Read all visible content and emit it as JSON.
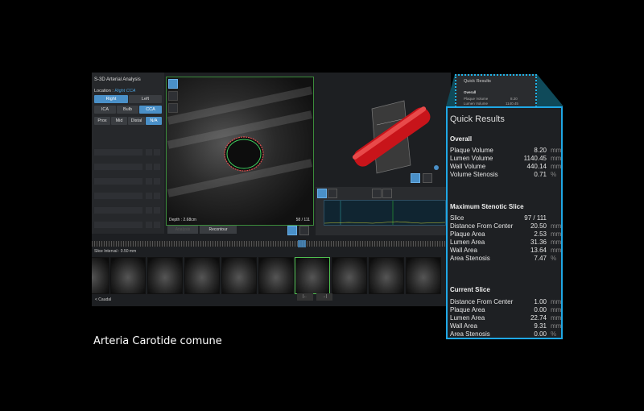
{
  "app": {
    "title": "S-3D Arterial Analysis",
    "location_label": "Location :",
    "location_value": "Right CCA",
    "side_buttons": [
      "Right",
      "Left"
    ],
    "segment_buttons": [
      "ICA",
      "Bulb",
      "CCA"
    ],
    "position_buttons": [
      "Prox",
      "Mid",
      "Distal",
      "N/A"
    ],
    "depth": "Depth : 2.68cm",
    "slice_counter": "58 / 111",
    "analysis_button": "Analysis",
    "recontour_button": "Recontour",
    "slice_interval": "Slice Interval : 0.50 mm",
    "caudal": "< Caudal",
    "nav_prev": "|←",
    "nav_next": "→|",
    "accent_color": "#4a90c8"
  },
  "quick_results_small": {
    "title": "Quick Results",
    "overall": "Overall",
    "rows": [
      {
        "label": "Plaque Volume",
        "value": "8.20"
      },
      {
        "label": "Lumen Volume",
        "value": "1140.45"
      }
    ]
  },
  "quick_results": {
    "title": "Quick Results",
    "border_color": "#1fa8e6",
    "overall": {
      "heading": "Overall",
      "rows": [
        {
          "label": "Plaque Volume",
          "value": "8.20",
          "unit": "mm"
        },
        {
          "label": "Lumen Volume",
          "value": "1140.45",
          "unit": "mm"
        },
        {
          "label": "Wall Volume",
          "value": "440.14",
          "unit": "mm"
        },
        {
          "label": "Volume Stenosis",
          "value": "0.71",
          "unit": "%"
        }
      ]
    },
    "max_stenotic": {
      "heading": "Maximum Stenotic Slice",
      "rows": [
        {
          "label": "Slice",
          "value": "97 / 111",
          "unit": ""
        },
        {
          "label": "Distance From Center",
          "value": "20.50",
          "unit": "mm"
        },
        {
          "label": "Plaque Area",
          "value": "2.53",
          "unit": "mm"
        },
        {
          "label": "Lumen Area",
          "value": "31.36",
          "unit": "mm"
        },
        {
          "label": "Wall Area",
          "value": "13.64",
          "unit": "mm"
        },
        {
          "label": "Area Stenosis",
          "value": "7.47",
          "unit": "%"
        }
      ]
    },
    "current": {
      "heading": "Current Slice",
      "rows": [
        {
          "label": "Distance From Center",
          "value": "1.00",
          "unit": "mm"
        },
        {
          "label": "Plaque Area",
          "value": "0.00",
          "unit": "mm"
        },
        {
          "label": "Lumen Area",
          "value": "22.74",
          "unit": "mm"
        },
        {
          "label": "Wall Area",
          "value": "9.31",
          "unit": "mm"
        },
        {
          "label": "Area Stenosis",
          "value": "0.00",
          "unit": "%"
        }
      ]
    }
  },
  "caption": "Arteria Carotide comune"
}
